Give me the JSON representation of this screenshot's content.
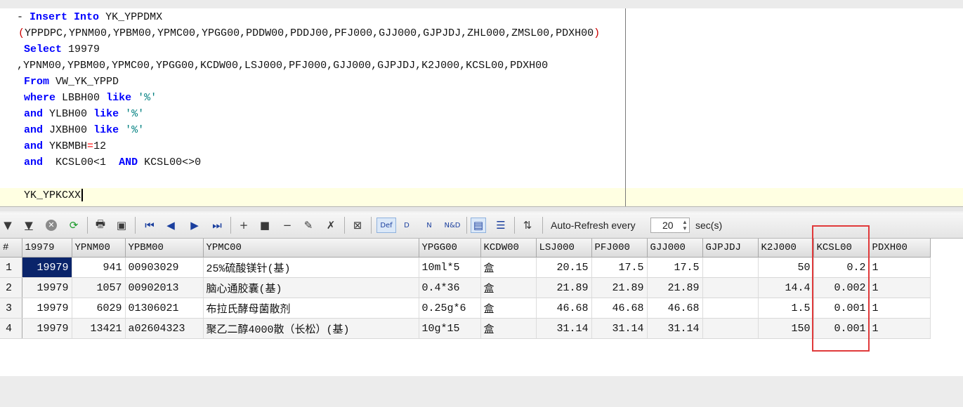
{
  "sql": {
    "line1_prefix": "- ",
    "line1_kw1": "Insert",
    "line1_kw2": "Into",
    "line1_table": "YK_YPPDMX",
    "line2_open": "(",
    "line2_cols": "YPPDPC,YPNM00,YPBM00,YPMC00,YPGG00,PDDW00,PDDJ00,PFJ000,GJJ000,GJPJDJ,ZHL000,ZMSL00,PDXH00",
    "line2_close": ")",
    "line3_kw": "Select",
    "line3_val": "19979",
    "line4": ",YPNM00,YPBM00,YPMC00,YPGG00,KCDW00,LSJ000,PFJ000,GJJ000,GJPJDJ,K2J000,KCSL00,PDXH00",
    "line5_kw": "From",
    "line5_rest": "VW_YK_YPPD",
    "line6_kw": "where",
    "line6_col": "LBBH00",
    "line6_kw2": "like",
    "line6_str": "'%'",
    "line7_kw": "and",
    "line7_col": "YLBH00",
    "line7_kw2": "like",
    "line7_str": "'%'",
    "line8_kw": "and",
    "line8_col": "JXBH00",
    "line8_kw2": "like",
    "line8_str": "'%'",
    "line9_kw": "and",
    "line9_col": "YKBMBH",
    "line9_op": "=",
    "line9_val": "12",
    "line10_kw": "and",
    "line10_cond1": "KCSL00<1",
    "line10_kw2": "AND",
    "line10_cond2": "KCSL00<>0",
    "line12": "YK_YPKCXX"
  },
  "toolbar": {
    "auto_refresh_label": "Auto-Refresh every",
    "refresh_interval": "20",
    "unit_label": "sec(s)",
    "def_label": "Def",
    "d_label": "D",
    "n_label": "N",
    "nd_label": "N&D"
  },
  "grid": {
    "columns": [
      "#",
      "19979",
      "YPNM00",
      "YPBM00",
      "YPMC00",
      "YPGG00",
      "KCDW00",
      "LSJ000",
      "PFJ000",
      "GJJ000",
      "GJPJDJ",
      "K2J000",
      "KCSL00",
      "PDXH00"
    ],
    "rows": [
      {
        "n": "1",
        "c1": "19979",
        "ypnm": "941",
        "ypbm": "00903029",
        "ypmc": "25%硫酸镁针(基)",
        "ypgg": "10ml*5",
        "kcdw": "盒",
        "lsj": "20.15",
        "pfj": "17.5",
        "gjj": "17.5",
        "gjpjdj": "",
        "k2j": "50",
        "kcsl": "0.2",
        "pdxh": "1"
      },
      {
        "n": "2",
        "c1": "19979",
        "ypnm": "1057",
        "ypbm": "00902013",
        "ypmc": "脑心通胶囊(基)",
        "ypgg": "0.4*36",
        "kcdw": "盒",
        "lsj": "21.89",
        "pfj": "21.89",
        "gjj": "21.89",
        "gjpjdj": "",
        "k2j": "14.4",
        "kcsl": "0.002",
        "pdxh": "1"
      },
      {
        "n": "3",
        "c1": "19979",
        "ypnm": "6029",
        "ypbm": "01306021",
        "ypmc": "布拉氏酵母菌散剂",
        "ypgg": "0.25g*6",
        "kcdw": "盒",
        "lsj": "46.68",
        "pfj": "46.68",
        "gjj": "46.68",
        "gjpjdj": "",
        "k2j": "1.5",
        "kcsl": "0.001",
        "pdxh": "1"
      },
      {
        "n": "4",
        "c1": "19979",
        "ypnm": "13421",
        "ypbm": "a02604323",
        "ypmc": "聚乙二醇4000散（长松）(基)",
        "ypgg": "10g*15",
        "kcdw": "盒",
        "lsj": "31.14",
        "pfj": "31.14",
        "gjj": "31.14",
        "gjpjdj": "",
        "k2j": "150",
        "kcsl": "0.001",
        "pdxh": "1"
      }
    ]
  }
}
